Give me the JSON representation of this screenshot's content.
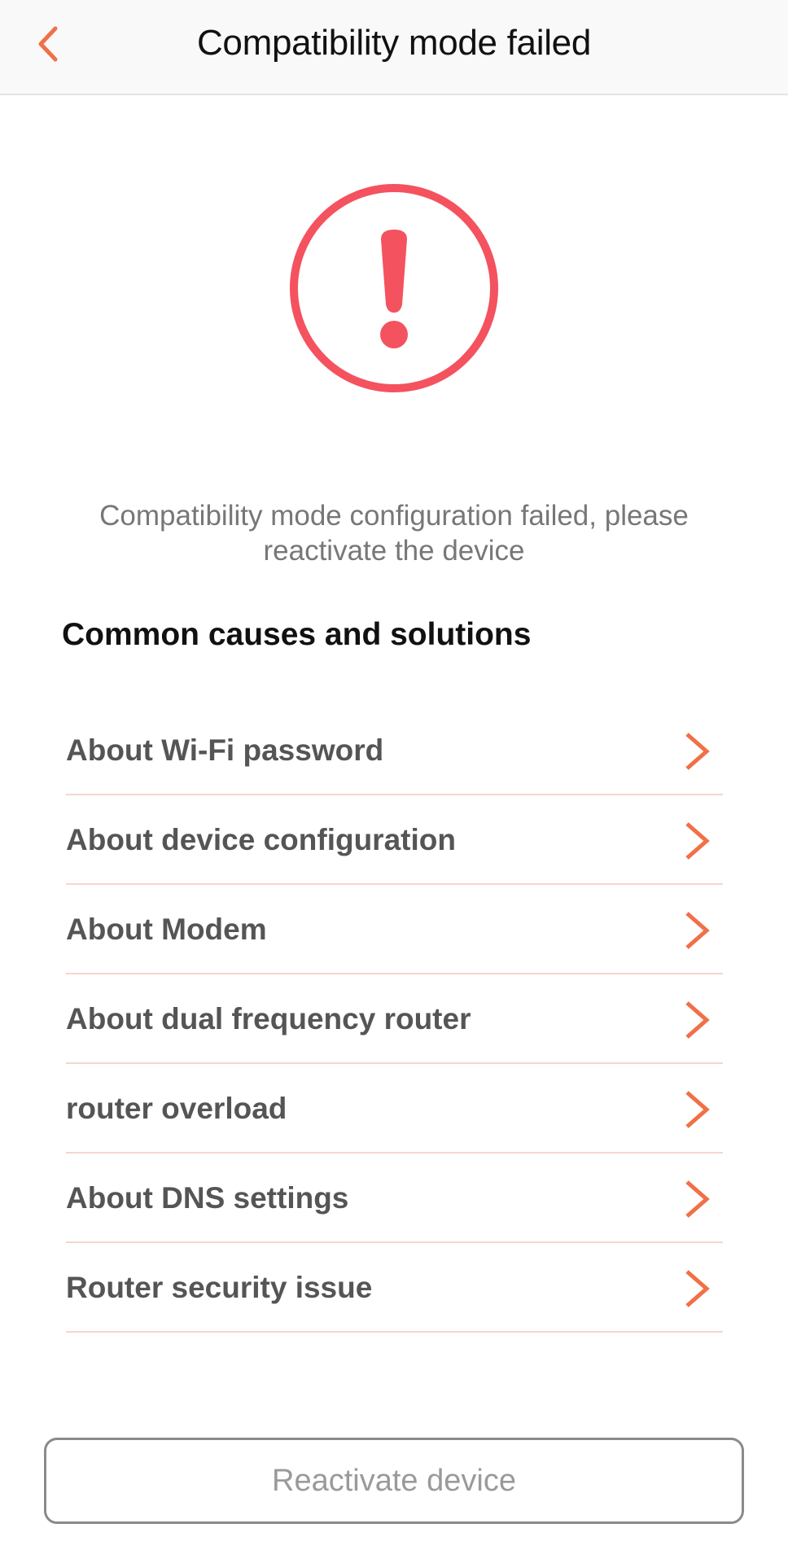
{
  "header": {
    "title": "Compatibility mode failed",
    "back_icon": "chevron-left-icon"
  },
  "status": {
    "icon": "exclamation-circle-icon",
    "message": "Compatibility mode configuration failed, please reactivate the device"
  },
  "section": {
    "title": "Common causes and solutions"
  },
  "items": [
    {
      "label": "About Wi-Fi password"
    },
    {
      "label": "About device configuration"
    },
    {
      "label": "About Modem"
    },
    {
      "label": "About dual frequency router"
    },
    {
      "label": "router overload"
    },
    {
      "label": "About DNS settings"
    },
    {
      "label": "Router security issue"
    }
  ],
  "footer": {
    "button_label": "Reactivate device"
  },
  "colors": {
    "accent": "#f07048",
    "alert": "#f4525f",
    "divider": "#f5d6cc",
    "header_bg": "#f9f9f9"
  }
}
